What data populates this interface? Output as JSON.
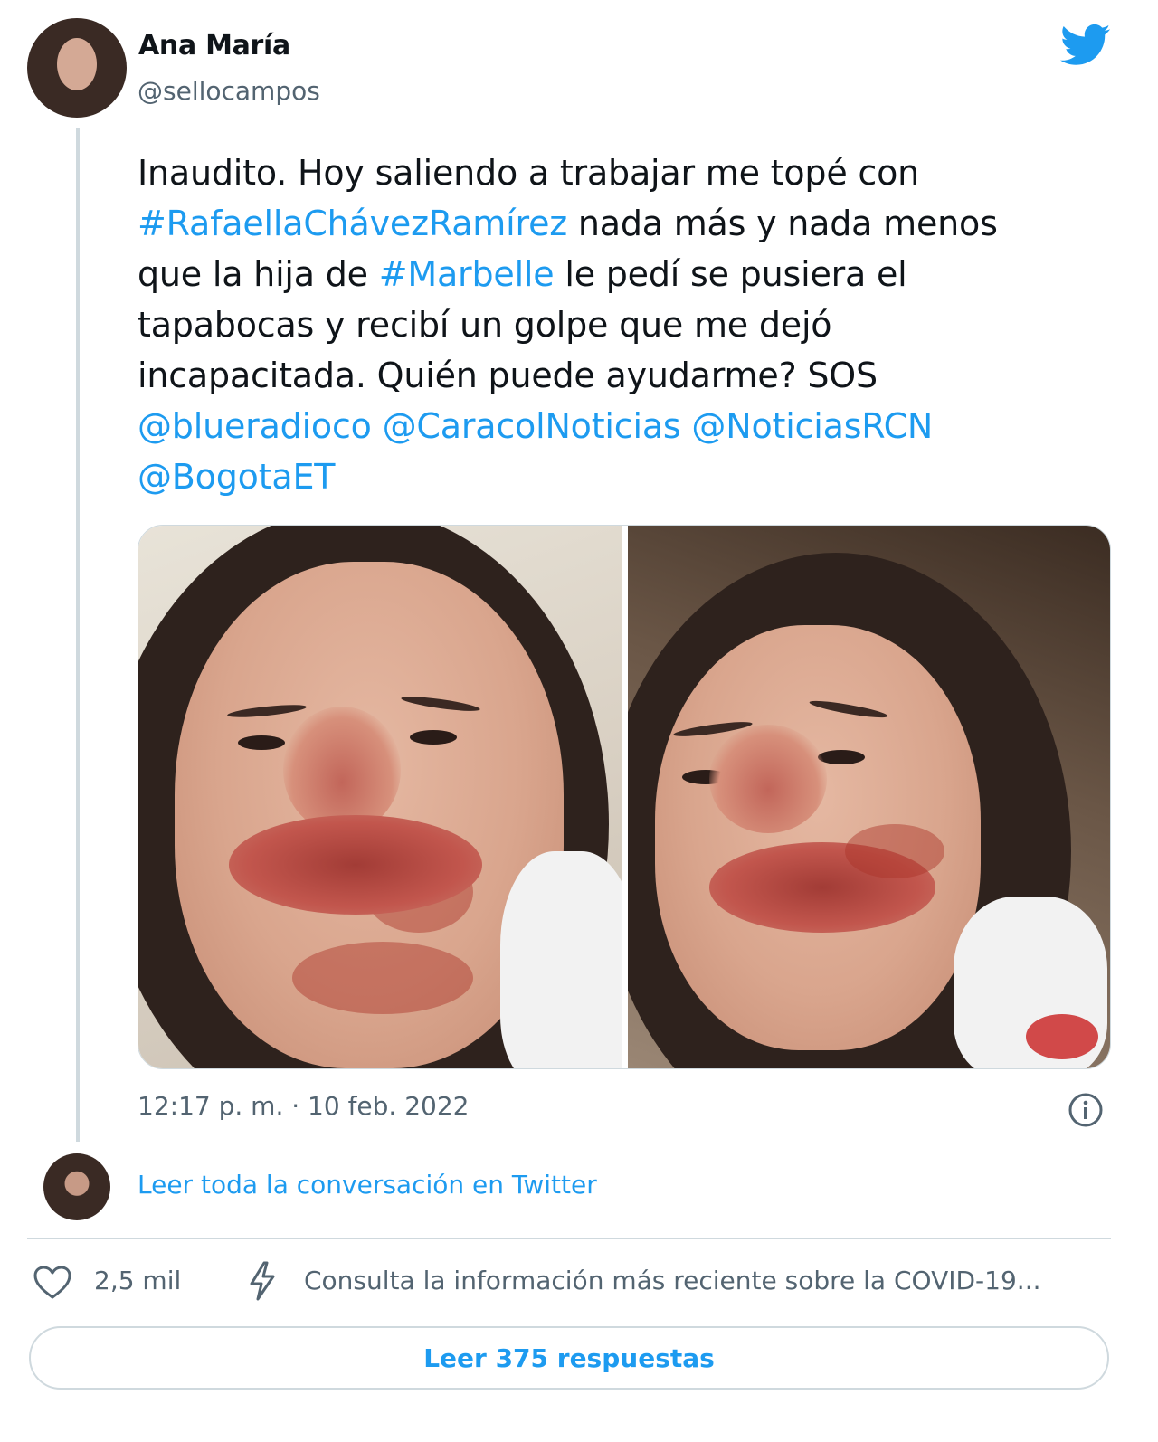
{
  "author": {
    "name": "Ana María",
    "handle": "@sellocampos"
  },
  "tweet": {
    "lines": [
      [
        {
          "text": "Inaudito. Hoy saliendo a trabajar me topé con",
          "type": "text"
        }
      ],
      [
        {
          "text": "#RafaellaChávezRamírez",
          "type": "hashtag"
        },
        {
          "text": " nada más y nada menos",
          "type": "text"
        }
      ],
      [
        {
          "text": "que la hija de ",
          "type": "text"
        },
        {
          "text": "#Marbelle",
          "type": "hashtag"
        },
        {
          "text": " le pedí se pusiera el",
          "type": "text"
        }
      ],
      [
        {
          "text": "tapabocas y recibí un golpe que me dejó",
          "type": "text"
        }
      ],
      [
        {
          "text": "incapacitada. Quién puede ayudarme? SOS",
          "type": "text"
        }
      ],
      [
        {
          "text": "@blueradioco",
          "type": "mention"
        },
        {
          "text": " ",
          "type": "text"
        },
        {
          "text": "@CaracolNoticias",
          "type": "mention"
        },
        {
          "text": "  ",
          "type": "text"
        },
        {
          "text": "@NoticiasRCN",
          "type": "mention"
        }
      ],
      [
        {
          "text": "@BogotaET",
          "type": "mention"
        }
      ]
    ],
    "timestamp": "12:17 p. m. · 10 feb. 2022"
  },
  "thread": {
    "read_conversation": "Leer toda la conversación en Twitter"
  },
  "footer": {
    "likes": "2,5 mil",
    "covid_notice": "Consulta la información más reciente sobre la COVID-19...",
    "replies_button": "Leer 375 respuestas"
  },
  "icons": {
    "brand": "twitter-bird-icon",
    "info": "info-icon",
    "like": "heart-icon",
    "covid": "bolt-icon"
  },
  "colors": {
    "link": "#1d9bf0",
    "secondary_text": "#536471",
    "border": "#cfd9de",
    "brand": "#1d9bf0"
  }
}
